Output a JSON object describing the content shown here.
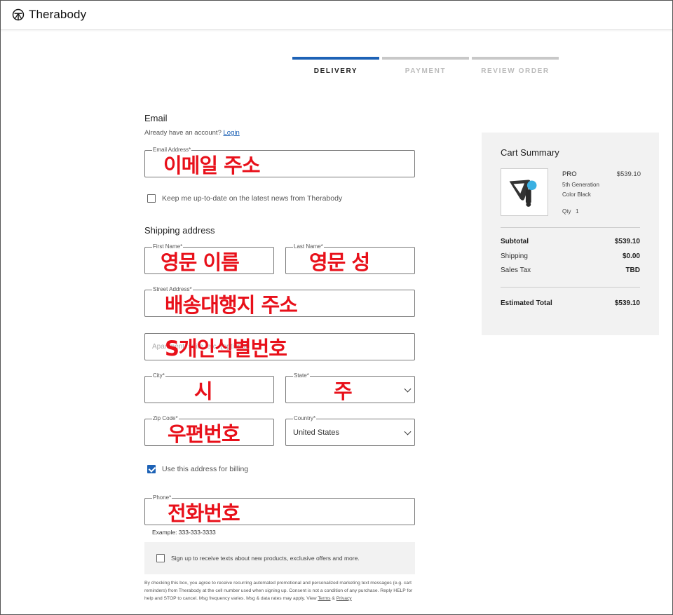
{
  "header": {
    "brand": "Therabody"
  },
  "steps": [
    {
      "label": "DELIVERY",
      "active": true
    },
    {
      "label": "PAYMENT",
      "active": false
    },
    {
      "label": "REVIEW ORDER",
      "active": false
    }
  ],
  "email_section": {
    "title": "Email",
    "account_prompt": "Already have an account?",
    "login_link": "Login",
    "email_label": "Email Address*",
    "email_value": "이메일 주소",
    "newsletter_label": "Keep me up-to-date on the latest news from Therabody",
    "newsletter_checked": false
  },
  "shipping": {
    "title": "Shipping address",
    "first_name_label": "First Name*",
    "first_name_value": "영문 이름",
    "last_name_label": "Last Name*",
    "last_name_value": "영문 성",
    "street_label": "Street Address*",
    "street_value": "배송대행지 주소",
    "apt_placeholder": "Apartment, suite, etc. (optional)",
    "apt_value": "S개인식별번호",
    "city_label": "City*",
    "city_value": "시",
    "state_label": "State*",
    "state_value": "주",
    "zip_label": "Zip Code*",
    "zip_value": "우편번호",
    "country_label": "Country*",
    "country_value": "United States",
    "billing_label": "Use this address for billing",
    "billing_checked": true,
    "phone_label": "Phone*",
    "phone_value": "전화번호",
    "phone_example": "Example: 333-333-3333",
    "sms_label": "Sign up to receive texts about new products, exclusive offers and more.",
    "sms_checked": false,
    "legal_text": "By checking this box, you agree to receive recurring automated promotional and personalized marketing text messages (e.g. cart reminders) from Therabody at the cell number used when signing up. Consent is not a condition of any purchase. Reply HELP for help and STOP to cancel. Msg frequency varies. Msg & data rates may apply. View",
    "terms_link": "Terms",
    "legal_and": "&",
    "privacy_link": "Privacy"
  },
  "cart": {
    "title": "Cart Summary",
    "product_name": "PRO",
    "product_price": "$539.10",
    "product_generation": "5th Generation",
    "product_color": "Color Black",
    "qty_label": "Qty",
    "qty_value": "1",
    "subtotal_label": "Subtotal",
    "subtotal_value": "$539.10",
    "shipping_label": "Shipping",
    "shipping_value": "$0.00",
    "tax_label": "Sales Tax",
    "tax_value": "TBD",
    "total_label": "Estimated Total",
    "total_value": "$539.10"
  },
  "colors": {
    "accent": "#1d62b6",
    "annotation": "#e8101a",
    "panel": "#f2f2f2"
  },
  "icons": {
    "logo": "therabody-logo-icon",
    "product": "massage-gun-icon",
    "select": "chevron-down-icon",
    "checkbox": "checkbox-icon"
  }
}
